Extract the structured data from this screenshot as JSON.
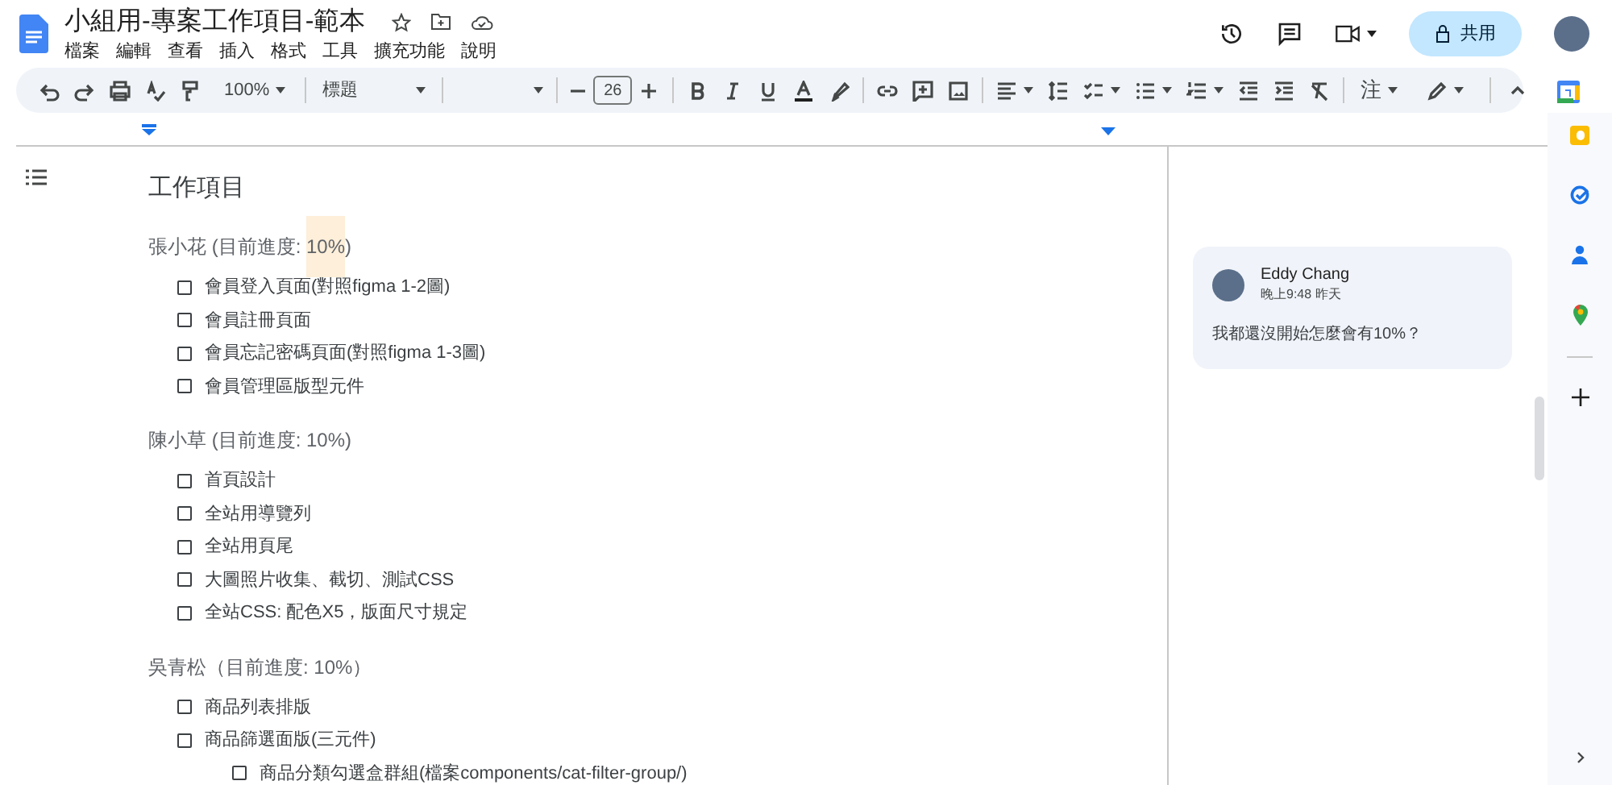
{
  "document": {
    "title": "小組用-專案工作項目-範本"
  },
  "menu": [
    "檔案",
    "編輯",
    "查看",
    "插入",
    "格式",
    "工具",
    "擴充功能",
    "說明"
  ],
  "share_button": {
    "label": "共用"
  },
  "toolbar": {
    "zoom": "100%",
    "style": "標題",
    "font_size": "26",
    "input_tool": "注"
  },
  "content": {
    "heading": "工作項目",
    "sections": [
      {
        "heading": [
          {
            "text": "張小花 (目前進度: ",
            "highlighted": false
          },
          {
            "text": "10%",
            "highlighted": true
          },
          {
            "text": ")",
            "highlighted": false
          }
        ],
        "tasks": [
          {
            "text": "會員登入頁面(對照figma 1-2圖)",
            "checked": false
          },
          {
            "text": "會員註冊頁面",
            "checked": false
          },
          {
            "text": "會員忘記密碼頁面(對照figma 1-3圖)",
            "checked": false
          },
          {
            "text": "會員管理區版型元件",
            "checked": false
          }
        ]
      },
      {
        "heading": [
          {
            "text": "陳小草 (目前進度: 10%)",
            "highlighted": false
          }
        ],
        "tasks": [
          {
            "text": "首頁設計",
            "checked": false
          },
          {
            "text": "全站用導覽列",
            "checked": false
          },
          {
            "text": "全站用頁尾",
            "checked": false
          },
          {
            "text": "大圖照片收集、截切、測試CSS",
            "checked": false
          },
          {
            "text": "全站CSS: 配色X5，版面尺寸規定",
            "checked": false
          }
        ]
      },
      {
        "heading": [
          {
            "text": "吳青松（目前進度: 10%）",
            "highlighted": false
          }
        ],
        "tasks": [
          {
            "text": "商品列表排版",
            "checked": false
          },
          {
            "text": "商品篩選面版(三元件)",
            "checked": false,
            "children": [
              {
                "text": "商品分類勾選盒群組(檔案components/cat-filter-group/)",
                "checked": false
              }
            ]
          }
        ]
      }
    ]
  },
  "comment": {
    "author": "Eddy Chang",
    "time": "晚上9:48 昨天",
    "text": "我都還沒開始怎麼會有10%？"
  }
}
